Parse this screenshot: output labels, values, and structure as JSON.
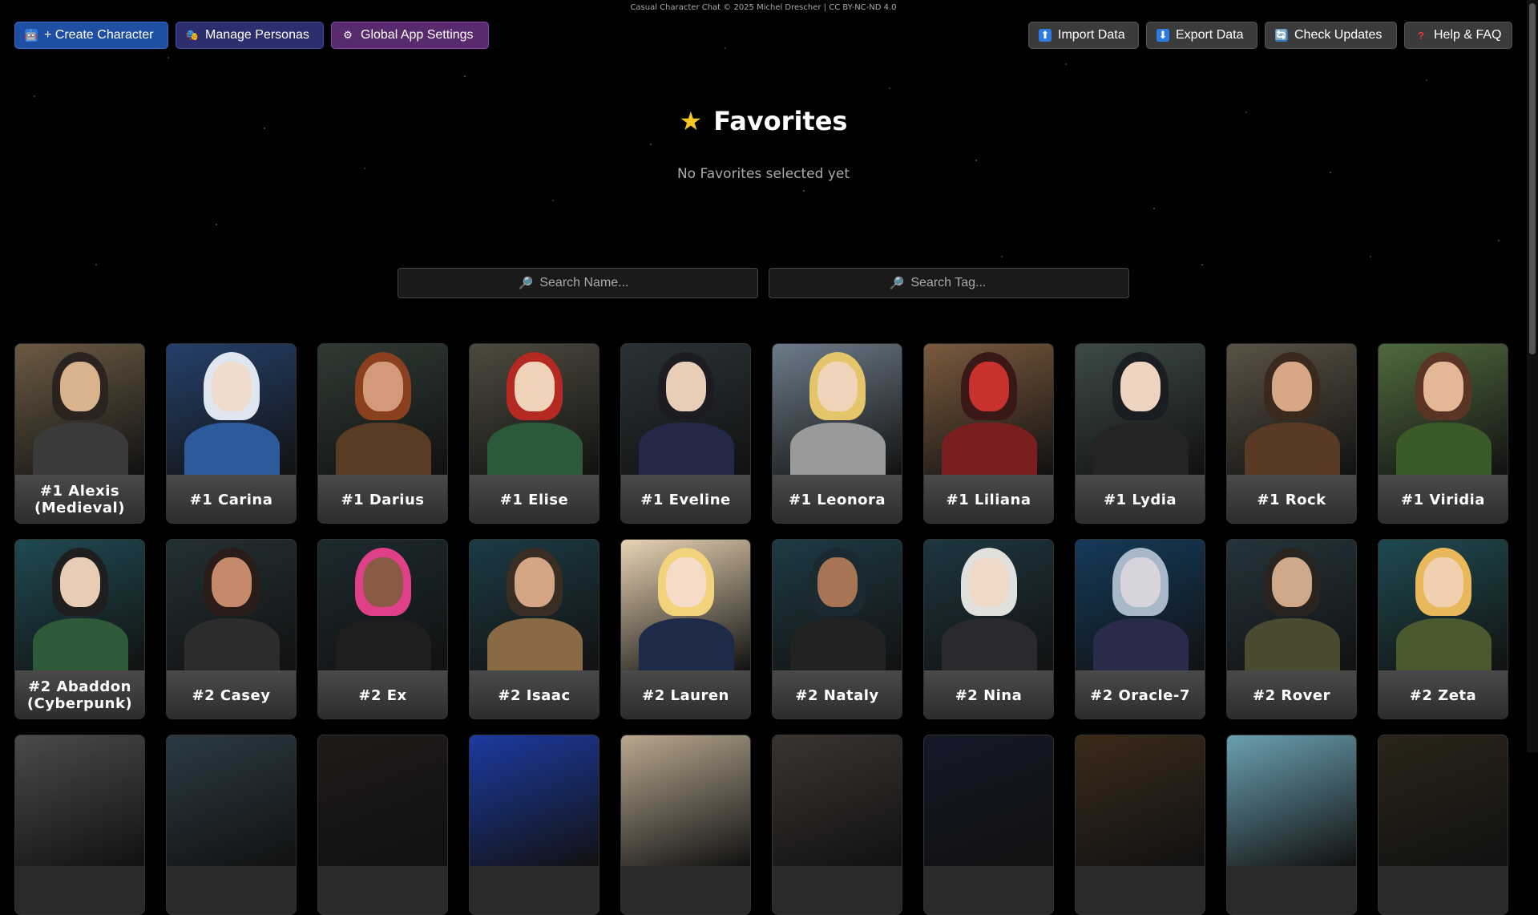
{
  "copyright": "Casual Character Chat © 2025 Michel Drescher | CC BY-NC-ND 4.0",
  "toolbar_left": [
    {
      "icon": "robot-icon",
      "glyph": "🤖",
      "label": "+ Create Character"
    },
    {
      "icon": "theater-masks-icon",
      "glyph": "🎭",
      "label": "Manage Personas"
    },
    {
      "icon": "gear-icon",
      "glyph": "⚙",
      "label": "Global App Settings"
    }
  ],
  "toolbar_right": [
    {
      "icon": "upload-icon",
      "glyph": "⬆",
      "label": "Import Data"
    },
    {
      "icon": "download-icon",
      "glyph": "⬇",
      "label": "Export Data"
    },
    {
      "icon": "refresh-icon",
      "glyph": "🔄",
      "label": "Check Updates"
    },
    {
      "icon": "question-icon",
      "glyph": "?",
      "label": "Help & FAQ"
    }
  ],
  "favorites": {
    "title": "Favorites",
    "empty_text": "No Favorites selected yet"
  },
  "search": {
    "name_placeholder": "Search Name...",
    "tag_placeholder": "Search Tag..."
  },
  "characters_row1": [
    {
      "name": "#1 Alexis (Medieval)",
      "bg": "#6b5a44",
      "hair": "#2a2320",
      "skin": "#d9b38c",
      "outfit": "#3a3a3a"
    },
    {
      "name": "#1 Carina",
      "bg": "#25406b",
      "hair": "#dfe6f0",
      "skin": "#f0dccc",
      "outfit": "#2d5a9a"
    },
    {
      "name": "#1 Darius",
      "bg": "#2f3a33",
      "hair": "#8a3f1e",
      "skin": "#d29a78",
      "outfit": "#5a3b24"
    },
    {
      "name": "#1 Elise",
      "bg": "#4d4a3e",
      "hair": "#b42a22",
      "skin": "#f0d2b8",
      "outfit": "#2b5a3a"
    },
    {
      "name": "#1 Eveline",
      "bg": "#2a3236",
      "hair": "#1c1c22",
      "skin": "#e8cdb7",
      "outfit": "#232848"
    },
    {
      "name": "#1 Leonora",
      "bg": "#6d7c8a",
      "hair": "#e4c56a",
      "skin": "#f0d4ba",
      "outfit": "#9a9a9a"
    },
    {
      "name": "#1 Liliana",
      "bg": "#7a5a3e",
      "hair": "#3a1818",
      "skin": "#c8322c",
      "outfit": "#7a1f1f"
    },
    {
      "name": "#1 Lydia",
      "bg": "#3c4a46",
      "hair": "#1a1d22",
      "skin": "#ecd4c0",
      "outfit": "#242424"
    },
    {
      "name": "#1 Rock",
      "bg": "#5a5244",
      "hair": "#3a2a1e",
      "skin": "#d8a886",
      "outfit": "#5a3a24"
    },
    {
      "name": "#1 Viridia",
      "bg": "#4f6a3e",
      "hair": "#5a3424",
      "skin": "#e4b896",
      "outfit": "#3a5a2a"
    }
  ],
  "characters_row2": [
    {
      "name": "#2 Abaddon (Cyberpunk)",
      "bg": "#1f4a52",
      "hair": "#1e1e1e",
      "skin": "#e8cdb4",
      "outfit": "#2e5a3a"
    },
    {
      "name": "#2 Casey",
      "bg": "#233034",
      "hair": "#2a1c18",
      "skin": "#c48a6a",
      "outfit": "#2c2c2c"
    },
    {
      "name": "#2 Ex",
      "bg": "#1c2a2e",
      "hair": "#e0408a",
      "skin": "#8a5a44",
      "outfit": "#1e1e1e"
    },
    {
      "name": "#2 Isaac",
      "bg": "#1c3a44",
      "hair": "#3a2e24",
      "skin": "#d4a684",
      "outfit": "#8a6a44"
    },
    {
      "name": "#2 Lauren",
      "bg": "#e8d4b4",
      "hair": "#f2d27a",
      "skin": "#f4dcc8",
      "outfit": "#1e2a4a"
    },
    {
      "name": "#2 Nataly",
      "bg": "#1e3a44",
      "hair": "#1a2a30",
      "skin": "#a87456",
      "outfit": "#222"
    },
    {
      "name": "#2 Nina",
      "bg": "#1e3640",
      "hair": "#e0e0dc",
      "skin": "#eed8c8",
      "outfit": "#2a2a2e"
    },
    {
      "name": "#2 Oracle-7",
      "bg": "#143a5a",
      "hair": "#a8b8c8",
      "skin": "#d8d4dc",
      "outfit": "#2a2a4a"
    },
    {
      "name": "#2 Rover",
      "bg": "#24343c",
      "hair": "#2a2420",
      "skin": "#d0a88a",
      "outfit": "#4a4a30"
    },
    {
      "name": "#2 Zeta",
      "bg": "#1e4a50",
      "hair": "#e8b85a",
      "skin": "#f0d0b0",
      "outfit": "#4a5a2e"
    }
  ],
  "characters_row3": [
    {
      "bg": "#4a4a4a"
    },
    {
      "bg": "#2a3a44"
    },
    {
      "bg": "#1e1a18"
    },
    {
      "bg": "#1c3aa0"
    },
    {
      "bg": "#b8a890"
    },
    {
      "bg": "#3a3430"
    },
    {
      "bg": "#141828"
    },
    {
      "bg": "#3a2a1a"
    },
    {
      "bg": "#6aa0b0"
    },
    {
      "bg": "#2a2418"
    }
  ]
}
